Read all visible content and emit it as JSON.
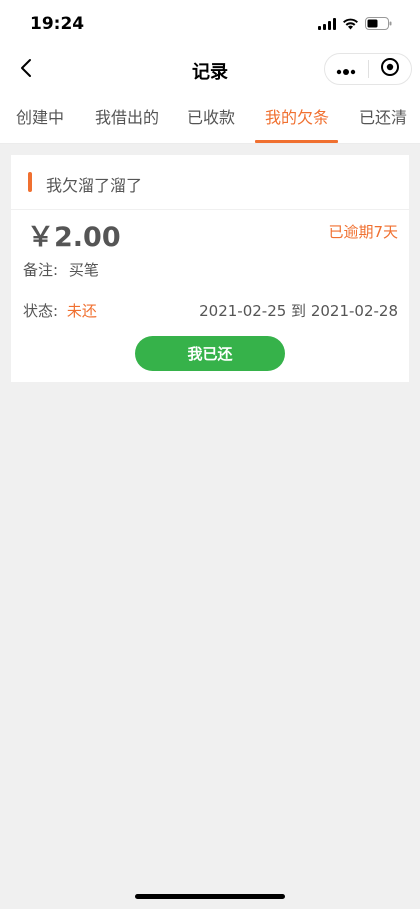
{
  "status_bar": {
    "time": "19:24",
    "icons": [
      "signal-icon",
      "wifi-icon",
      "battery-icon"
    ]
  },
  "nav": {
    "title": "记录",
    "icons": [
      "back-chevron-icon",
      "more-dots-icon",
      "target-close-icon"
    ]
  },
  "tabs": [
    {
      "label": "创建中",
      "active": false
    },
    {
      "label": "我借出的",
      "active": false
    },
    {
      "label": "已收款",
      "active": false
    },
    {
      "label": "我的欠条",
      "active": true
    },
    {
      "label": "已还清",
      "active": false
    }
  ],
  "card": {
    "title": "我欠溜了溜了",
    "amount": "￥2.00",
    "overdue_text": "已逾期7天",
    "remark_label": "备注:",
    "remark_value": "买笔",
    "status_label": "状态:",
    "status_value": "未还",
    "date_range": "2021-02-25 到 2021-02-28",
    "button_label": "我已还"
  },
  "colors": {
    "accent": "#f07030",
    "button_green": "#36b24a",
    "background": "#f0f0f0"
  }
}
